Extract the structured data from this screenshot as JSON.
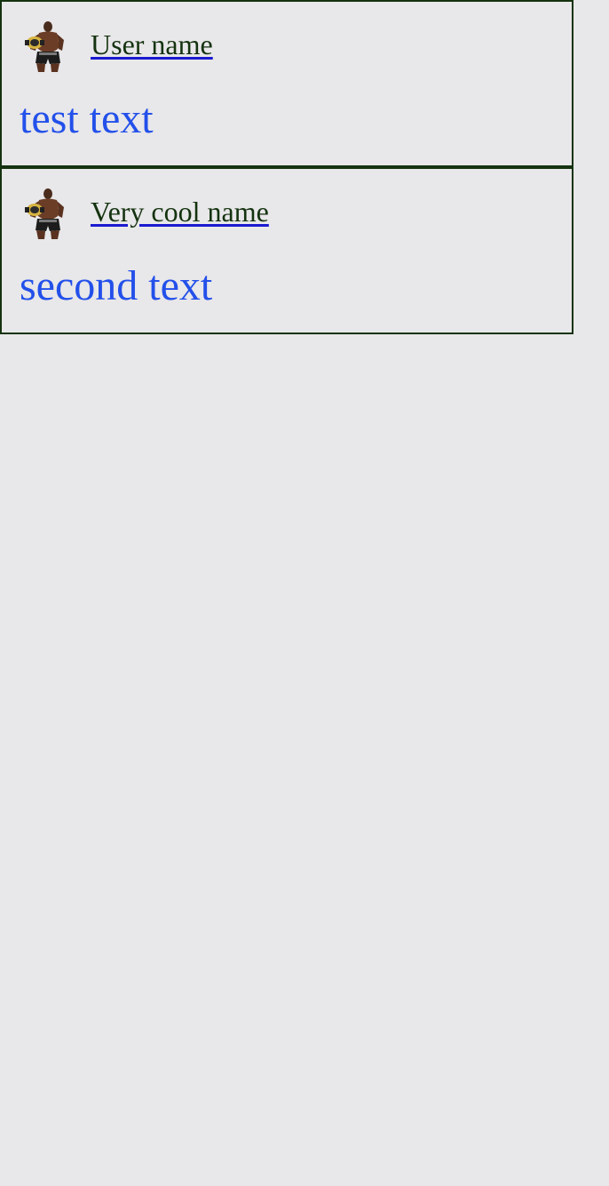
{
  "colors": {
    "background": "#e8e7e9",
    "border": "#14330f",
    "username_text": "#14330f",
    "username_underline": "#1a1ad0",
    "post_text": "#2350ea"
  },
  "posts": [
    {
      "avatar_icon": "fighter-avatar-icon",
      "username": "User name",
      "text": "test text"
    },
    {
      "avatar_icon": "fighter-avatar-icon",
      "username": "Very cool name",
      "text": "second text"
    }
  ]
}
